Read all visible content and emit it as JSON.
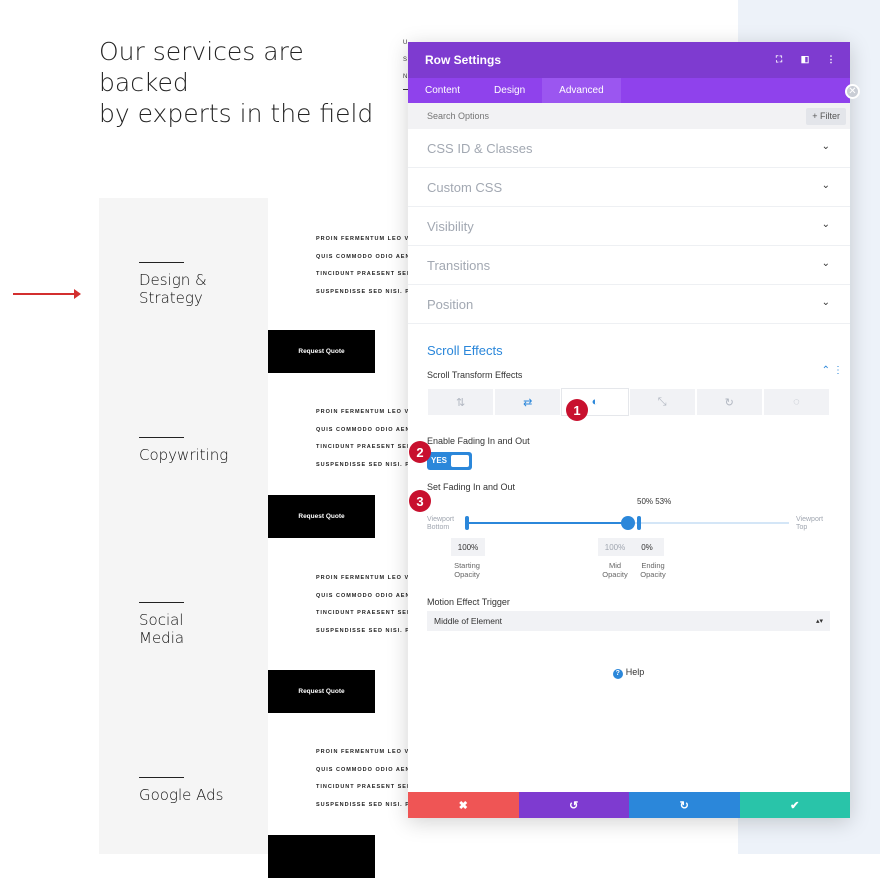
{
  "page": {
    "heading_line1": "Our services are backed",
    "heading_line2": "by experts in the field",
    "edge_fragments": [
      "U",
      "S",
      "N"
    ],
    "services": [
      {
        "name": "Design &\nStrategy"
      },
      {
        "name": "Copywriting"
      },
      {
        "name": "Social\nMedia"
      },
      {
        "name": "Google Ads"
      }
    ],
    "body_lines": [
      "PROIN FERMENTUM LEO VE",
      "QUIS COMMODO ODIO AEN",
      "TINCIDUNT PRAESENT SEM",
      "SUSPENDISSE SED NISI. PU"
    ],
    "quote_button": "Request Quote"
  },
  "modal": {
    "title": "Row Settings",
    "tabs": [
      "Content",
      "Design",
      "Advanced"
    ],
    "active_tab": "Advanced",
    "search_placeholder": "Search Options",
    "filter_label": "+ Filter",
    "sections": [
      "CSS ID & Classes",
      "Custom CSS",
      "Visibility",
      "Transitions",
      "Position"
    ],
    "scroll_effects": {
      "title": "Scroll Effects",
      "transform_label": "Scroll Transform Effects",
      "enable_label": "Enable Fading In and Out",
      "toggle_value": "YES",
      "set_label": "Set Fading In and Out",
      "pct_label": "50% 53%",
      "viewport_bottom": "Viewport Bottom",
      "viewport_top": "Viewport Top",
      "starting_opacity": "100%",
      "mid_opacity": "100%",
      "ending_opacity": "0%",
      "starting_label": "Starting Opacity",
      "mid_label": "Mid Opacity",
      "ending_label": "Ending Opacity",
      "trigger_label": "Motion Effect Trigger",
      "trigger_value": "Middle of Element"
    },
    "help_label": "Help"
  },
  "badges": [
    "1",
    "2",
    "3"
  ],
  "colors": {
    "header": "#7e3bd0",
    "tabs": "#8f42ec",
    "accent": "#2b87da",
    "cancel": "#ef5555",
    "undo": "#7e3bd0",
    "redo": "#2b87da",
    "save": "#29c4a9",
    "badge": "#c8102e",
    "arrow": "#d32f2f"
  }
}
